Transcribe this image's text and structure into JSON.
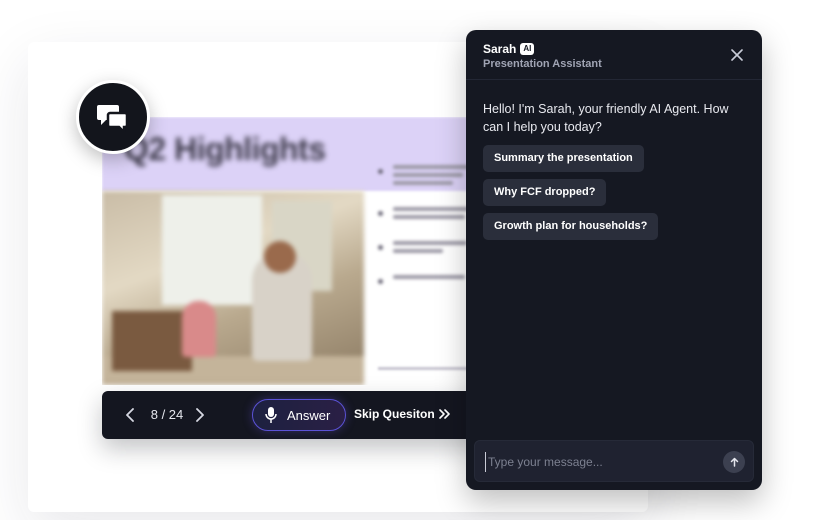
{
  "slide": {
    "title": "Q2 Highlights"
  },
  "controls": {
    "page_counter": "8 / 24",
    "answer_label": "Answer",
    "skip_label": "Skip Quesiton"
  },
  "chat": {
    "agent_name": "Sarah",
    "ai_badge": "AI",
    "agent_role": "Presentation Assistant",
    "greeting": "Hello! I'm Sarah, your friendly AI Agent. How can I help you today?",
    "suggestions": [
      "Summary the presentation",
      "Why FCF dropped?",
      "Growth plan for households?"
    ],
    "input_placeholder": "Type your message...",
    "input_value": ""
  },
  "colors": {
    "panel_bg": "#151822",
    "chip_bg": "#2a2e3b",
    "accent": "#5b52d6",
    "slide_header": "#dcd2f7"
  },
  "icons": {
    "fab": "chat-bubbles-icon",
    "prev": "chevron-left-icon",
    "next": "chevron-right-icon",
    "mic": "microphone-icon",
    "skip": "double-chevron-right-icon",
    "close": "close-icon",
    "send": "arrow-up-icon"
  }
}
